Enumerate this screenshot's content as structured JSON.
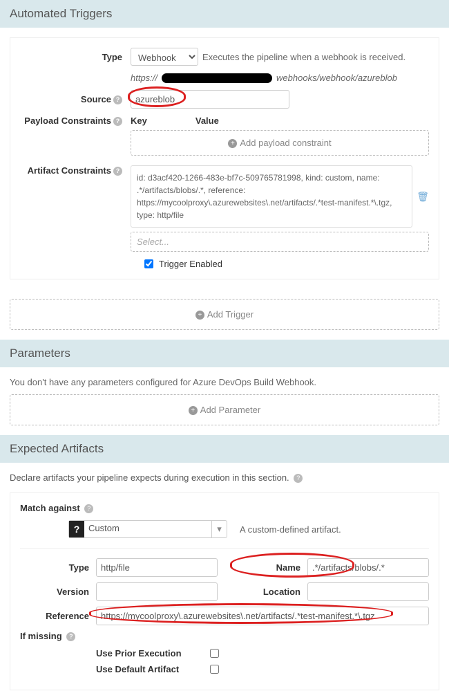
{
  "triggers": {
    "header": "Automated Triggers",
    "type_label": "Type",
    "type_value": "Webhook",
    "type_desc": "Executes the pipeline when a webhook is received.",
    "url_prefix": "https://",
    "url_suffix": "webhooks/webhook/azureblob",
    "source_label": "Source",
    "source_value": "azureblob",
    "payload_label": "Payload Constraints",
    "key_hdr": "Key",
    "value_hdr": "Value",
    "add_payload": "Add payload constraint",
    "artifact_label": "Artifact Constraints",
    "artifact_text": "id: d3acf420-1266-483e-bf7c-509765781998, kind: custom, name: .*/artifacts/blobs/.*, reference: https://mycoolproxy\\.azurewebsites\\.net/artifacts/.*test-manifest.*\\.tgz, type: http/file",
    "select_placeholder": "Select...",
    "trigger_enabled": "Trigger Enabled",
    "add_trigger": "Add Trigger"
  },
  "params": {
    "header": "Parameters",
    "msg": "You don't have any parameters configured for Azure DevOps Build Webhook.",
    "add_param": "Add Parameter"
  },
  "artifacts": {
    "header": "Expected Artifacts",
    "declare": "Declare artifacts your pipeline expects during execution in this section.",
    "match_against": "Match against",
    "custom_label": "Custom",
    "custom_desc": "A custom-defined artifact.",
    "type_label": "Type",
    "type_value": "http/file",
    "name_label": "Name",
    "name_value": ".*/artifacts/blobs/.*",
    "version_label": "Version",
    "version_value": "",
    "location_label": "Location",
    "location_value": "",
    "reference_label": "Reference",
    "reference_value": "https://mycoolproxy\\.azurewebsites\\.net/artifacts/.*test-manifest.*\\.tgz",
    "if_missing": "If missing",
    "use_prior": "Use Prior Execution",
    "use_default": "Use Default Artifact"
  }
}
